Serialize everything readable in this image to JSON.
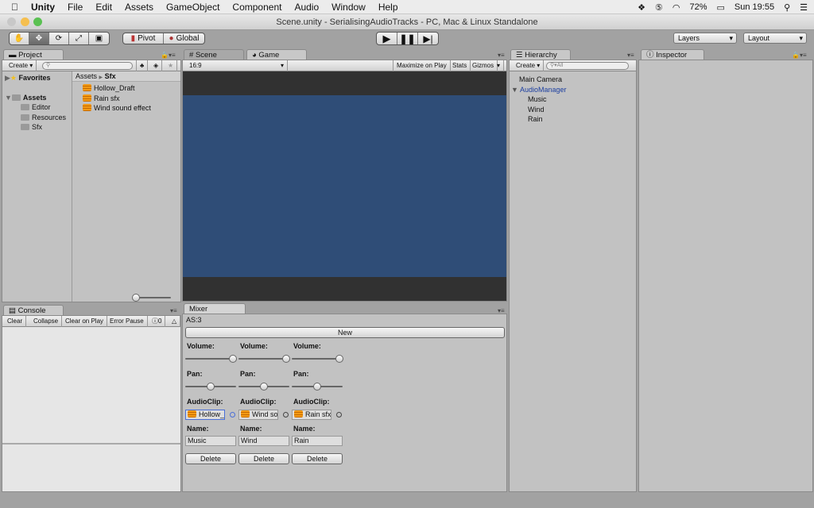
{
  "menubar": {
    "app": "Unity",
    "items": [
      "File",
      "Edit",
      "Assets",
      "GameObject",
      "Component",
      "Audio",
      "Window",
      "Help"
    ],
    "battery": "72%",
    "clock": "Sun 19:55"
  },
  "window": {
    "title": "Scene.unity - SerialisingAudioTracks - PC, Mac & Linux Standalone"
  },
  "toolbar": {
    "pivot": "Pivot",
    "global": "Global",
    "layers": "Layers",
    "layout": "Layout",
    "active_tool": "move"
  },
  "project": {
    "tab": "Project",
    "create": "Create",
    "favorites": "Favorites",
    "assets": "Assets",
    "folders": [
      "Editor",
      "Resources",
      "Sfx"
    ],
    "breadcrumb": [
      "Assets",
      "Sfx"
    ],
    "files": [
      "Hollow_Draft",
      "Rain sfx",
      "Wind sound effect"
    ]
  },
  "scene": {
    "scene_tab": "Scene",
    "game_tab": "Game",
    "aspect": "16:9",
    "maximize": "Maximize on Play",
    "stats": "Stats",
    "gizmos": "Gizmos",
    "colors": {
      "letterbox": "#313131",
      "camera": "#2f4d77"
    }
  },
  "hierarchy": {
    "tab": "Hierarchy",
    "create": "Create",
    "search_placeholder": "All",
    "items": [
      "Main Camera",
      "AudioManager",
      "Music",
      "Wind",
      "Rain"
    ],
    "selected": "AudioManager"
  },
  "inspector": {
    "tab": "Inspector"
  },
  "console": {
    "tab": "Console",
    "clear": "Clear",
    "collapse": "Collapse",
    "clear_on_play": "Clear on Play",
    "error_pause": "Error Pause",
    "count": "0"
  },
  "mixer": {
    "tab": "Mixer",
    "count_label": "AS:3",
    "new_label": "New",
    "volume_label": "Volume:",
    "pan_label": "Pan:",
    "clip_label": "AudioClip:",
    "name_label": "Name:",
    "delete_label": "Delete",
    "tracks": [
      {
        "volume": 1.0,
        "pan": 0.5,
        "clip": "Hollow_I",
        "name": "Music"
      },
      {
        "volume": 1.0,
        "pan": 0.5,
        "clip": "Wind sou",
        "name": "Wind"
      },
      {
        "volume": 1.0,
        "pan": 0.5,
        "clip": "Rain sfx",
        "name": "Rain"
      }
    ]
  }
}
